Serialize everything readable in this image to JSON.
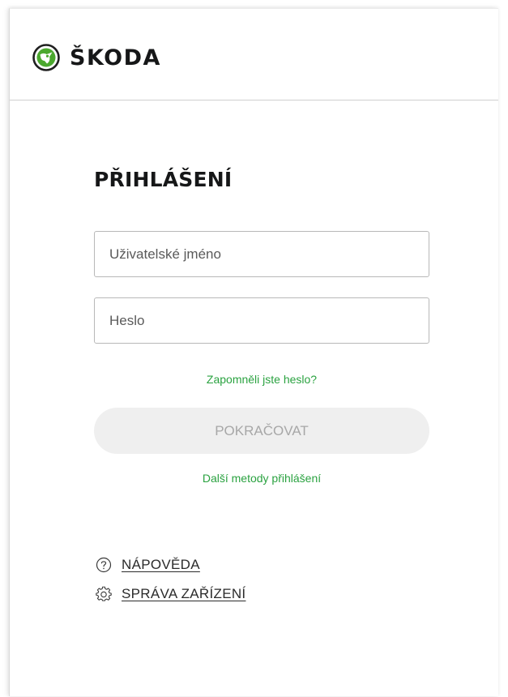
{
  "header": {
    "brand_name": "ŠKODA",
    "logo_icon": "skoda-winged-arrow-logo"
  },
  "login": {
    "title": "PŘIHLÁŠENÍ",
    "username_placeholder": "Uživatelské jméno",
    "password_placeholder": "Heslo",
    "forgot_password_link": "Zapomněli jste heslo?",
    "continue_button": "POKRAČOVAT",
    "other_methods_link": "Další metody přihlášení"
  },
  "footer": {
    "help_label": "NÁPOVĚDA",
    "help_icon": "question-circle-icon",
    "devices_label": "SPRÁVA ZAŘÍZENÍ",
    "devices_icon": "gear-icon"
  },
  "colors": {
    "accent_green": "#2aa240",
    "text_dark": "#161718",
    "button_disabled_bg": "#efefef",
    "button_disabled_text": "#a7a7a7"
  }
}
